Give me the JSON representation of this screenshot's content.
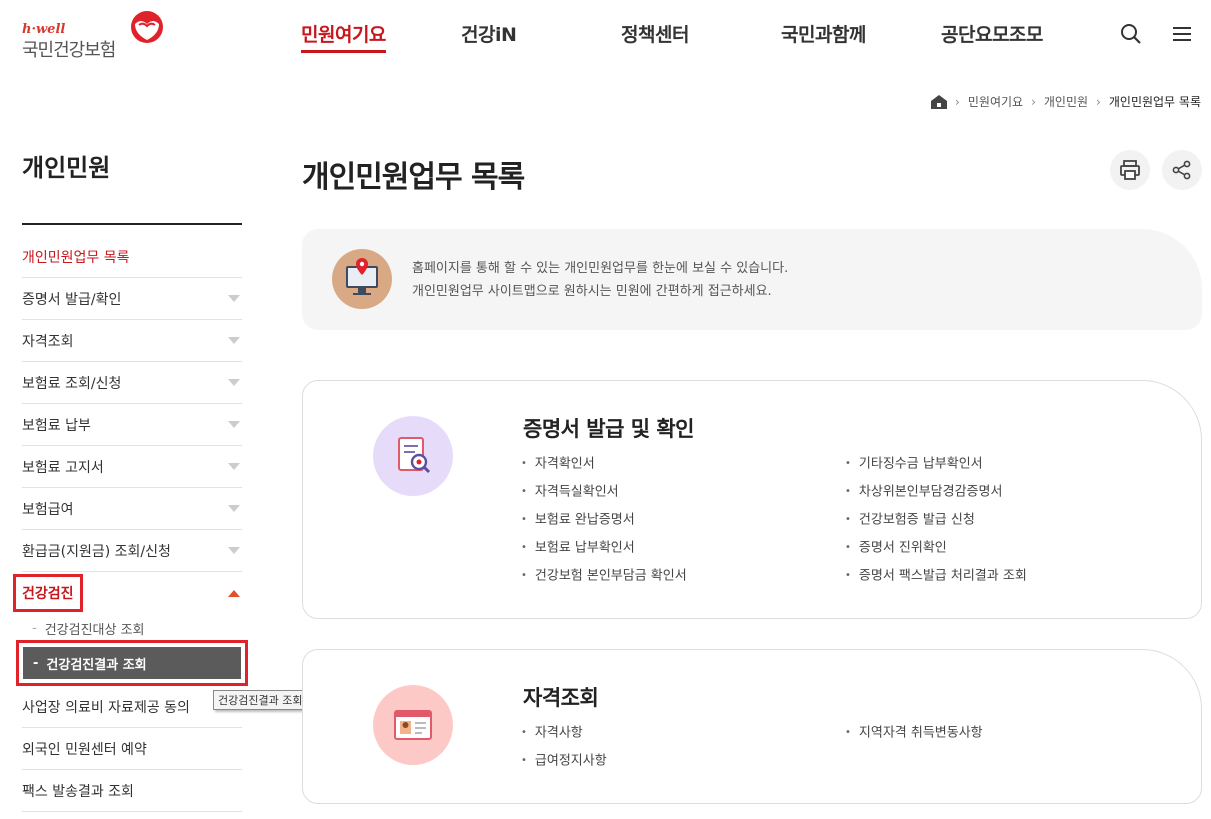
{
  "logo": {
    "small": "h·well",
    "main": "국민건강보험"
  },
  "gnb": [
    "민원여기요",
    "건강iN",
    "정책센터",
    "국민과함께",
    "공단요모조모"
  ],
  "breadcrumb": [
    "민원여기요",
    "개인민원",
    "개인민원업무 목록"
  ],
  "sidebar": {
    "title": "개인민원",
    "items": [
      "개인민원업무 목록",
      "증명서 발급/확인",
      "자격조회",
      "보험료 조회/신청",
      "보험료 납부",
      "보험료 고지서",
      "보험급여",
      "환급금(지원금) 조회/신청",
      "건강검진",
      "사업장 의료비 자료제공 동의",
      "외국인 민원센터 예약",
      "팩스 발송결과 조회"
    ],
    "sub": [
      "건강검진대상 조회",
      "건강검진결과 조회"
    ],
    "tooltip": "건강검진결과 조회"
  },
  "page_title": "개인민원업무 목록",
  "info": {
    "line1": "홈페이지를 통해 할 수 있는 개인민원업무를 한눈에 보실 수 있습니다.",
    "line2": "개인민원업무 사이트맵으로 원하시는 민원에 간편하게 접근하세요."
  },
  "cards": [
    {
      "title": "증명서 발급 및 확인",
      "left": [
        "자격확인서",
        "자격득실확인서",
        "보험료 완납증명서",
        "보험료 납부확인서",
        "건강보험 본인부담금 확인서"
      ],
      "right": [
        "기타징수금 납부확인서",
        "차상위본인부담경감증명서",
        "건강보험증 발급 신청",
        "증명서 진위확인",
        "증명서 팩스발급 처리결과 조회"
      ]
    },
    {
      "title": "자격조회",
      "left": [
        "자격사항",
        "급여정지사항"
      ],
      "right": [
        "지역자격 취득변동사항"
      ]
    }
  ],
  "colors": {
    "brand_red": "#c8161d",
    "highlight_outline": "#e0222a"
  }
}
